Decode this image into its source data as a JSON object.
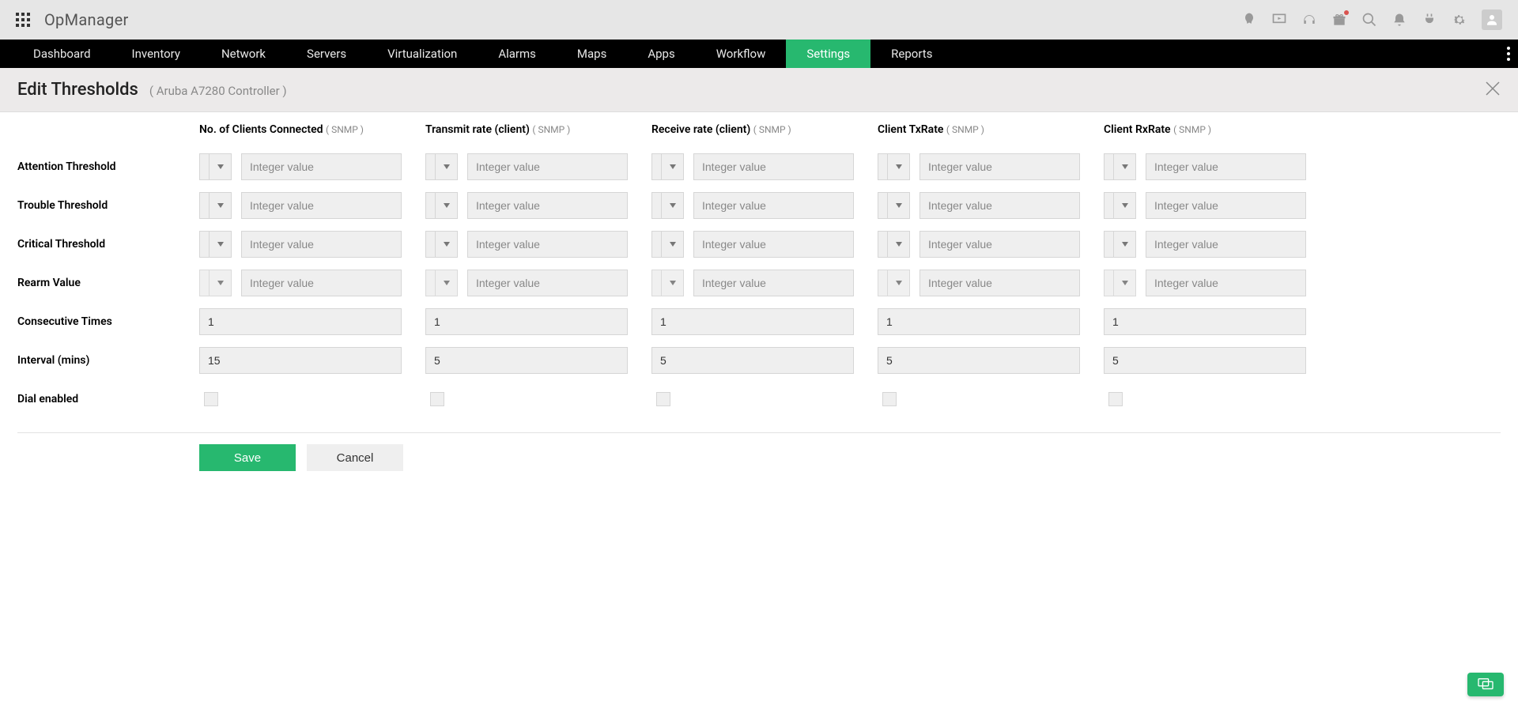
{
  "brand": "OpManager",
  "nav": [
    "Dashboard",
    "Inventory",
    "Network",
    "Servers",
    "Virtualization",
    "Alarms",
    "Maps",
    "Apps",
    "Workflow",
    "Settings",
    "Reports"
  ],
  "active_nav_index": 9,
  "page": {
    "title": "Edit Thresholds",
    "subtitle": "( Aruba A7280 Controller )"
  },
  "row_labels": [
    "Attention Threshold",
    "Trouble Threshold",
    "Critical Threshold",
    "Rearm Value",
    "Consecutive Times",
    "Interval (mins)",
    "Dial enabled"
  ],
  "value_placeholder": "Integer value",
  "columns": [
    {
      "name": "No. of Clients Connected",
      "protocol": "( SNMP )",
      "consecutive": "1",
      "interval": "15"
    },
    {
      "name": "Transmit rate (client)",
      "protocol": "( SNMP )",
      "consecutive": "1",
      "interval": "5"
    },
    {
      "name": "Receive rate (client)",
      "protocol": "( SNMP )",
      "consecutive": "1",
      "interval": "5"
    },
    {
      "name": "Client TxRate",
      "protocol": "( SNMP )",
      "consecutive": "1",
      "interval": "5"
    },
    {
      "name": "Client RxRate",
      "protocol": "( SNMP )",
      "consecutive": "1",
      "interval": "5"
    }
  ],
  "buttons": {
    "save": "Save",
    "cancel": "Cancel"
  }
}
